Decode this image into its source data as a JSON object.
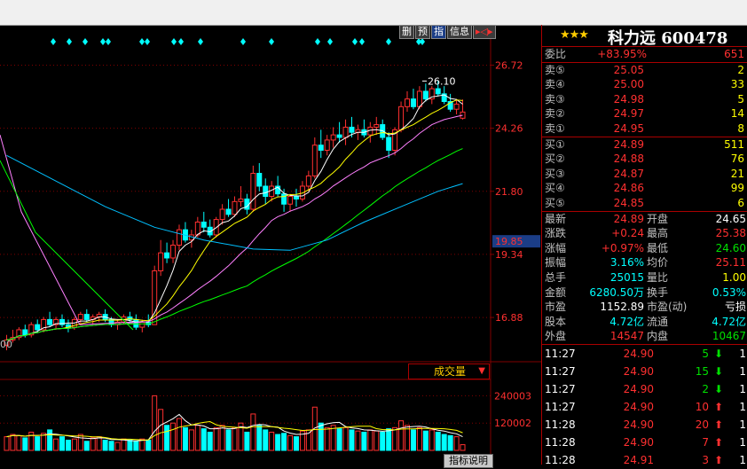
{
  "stock": {
    "stars": "★★★",
    "name": "科力远 600478"
  },
  "toolbox": [
    {
      "label": "删",
      "hl": false
    },
    {
      "label": "预",
      "hl": false
    },
    {
      "label": "指",
      "hl": true
    },
    {
      "label": "信息",
      "hl": false
    },
    {
      "label": "▸◁▸",
      "hl": false
    }
  ],
  "price_axis": {
    "ticks": [
      "26.72",
      "24.26",
      "21.80",
      "19.34",
      "16.88"
    ],
    "highlight": "19.85",
    "peak_label": "26.10",
    "left_label": "00"
  },
  "volume_axis": {
    "ticks": [
      "240003",
      "120002"
    ]
  },
  "volume_dropdown": {
    "label": "成交量",
    "arrow": "▼"
  },
  "indicator_button": "指标说明",
  "order_book": {
    "ratio": {
      "label": "委比",
      "value": "+83.95%",
      "qty": "651"
    },
    "sell": [
      {
        "label": "卖⑤",
        "price": "25.05",
        "qty": "2"
      },
      {
        "label": "卖④",
        "price": "25.00",
        "qty": "33"
      },
      {
        "label": "卖③",
        "price": "24.98",
        "qty": "5"
      },
      {
        "label": "卖②",
        "price": "24.97",
        "qty": "14"
      },
      {
        "label": "卖①",
        "price": "24.95",
        "qty": "8"
      }
    ],
    "buy": [
      {
        "label": "买①",
        "price": "24.89",
        "qty": "511"
      },
      {
        "label": "买②",
        "price": "24.88",
        "qty": "76"
      },
      {
        "label": "买③",
        "price": "24.87",
        "qty": "21"
      },
      {
        "label": "买④",
        "price": "24.86",
        "qty": "99"
      },
      {
        "label": "买⑤",
        "price": "24.85",
        "qty": "6"
      }
    ]
  },
  "stats": [
    {
      "l1": "最新",
      "v1": "24.89",
      "c1": "red",
      "l2": "开盘",
      "v2": "24.65",
      "c2": "white"
    },
    {
      "l1": "涨跌",
      "v1": "+0.24",
      "c1": "red",
      "l2": "最高",
      "v2": "25.38",
      "c2": "red"
    },
    {
      "l1": "涨幅",
      "v1": "+0.97%",
      "c1": "red",
      "l2": "最低",
      "v2": "24.60",
      "c2": "green"
    },
    {
      "l1": "振幅",
      "v1": "3.16%",
      "c1": "cyan",
      "l2": "均价",
      "v2": "25.11",
      "c2": "red"
    },
    {
      "l1": "总手",
      "v1": "25015",
      "c1": "cyan",
      "l2": "量比",
      "v2": "1.00",
      "c2": "yellow"
    },
    {
      "l1": "金额",
      "v1": "6280.50万",
      "c1": "cyan",
      "l2": "换手",
      "v2": "0.53%",
      "c2": "cyan"
    },
    {
      "l1": "市盈",
      "v1": "1152.89",
      "c1": "white",
      "l2": "市盈(动)",
      "v2": "亏损",
      "c2": "white"
    },
    {
      "l1": "股本",
      "v1": "4.72亿",
      "c1": "cyan",
      "l2": "流通",
      "v2": "4.72亿",
      "c2": "cyan"
    },
    {
      "l1": "外盘",
      "v1": "14547",
      "c1": "red",
      "l2": "内盘",
      "v2": "10467",
      "c2": "green"
    }
  ],
  "ticks": [
    {
      "time": "11:27",
      "price": "24.90",
      "vol": "5",
      "dir": "down",
      "n": "1"
    },
    {
      "time": "11:27",
      "price": "24.90",
      "vol": "15",
      "dir": "down",
      "n": "1"
    },
    {
      "time": "11:27",
      "price": "24.90",
      "vol": "2",
      "dir": "down",
      "n": "1"
    },
    {
      "time": "11:27",
      "price": "24.90",
      "vol": "10",
      "dir": "up",
      "n": "1"
    },
    {
      "time": "11:28",
      "price": "24.90",
      "vol": "20",
      "dir": "up",
      "n": "1"
    },
    {
      "time": "11:28",
      "price": "24.90",
      "vol": "7",
      "dir": "up",
      "n": "1"
    },
    {
      "time": "11:28",
      "price": "24.91",
      "vol": "3",
      "dir": "up",
      "n": "1"
    }
  ],
  "colors": {
    "up": "#ff3030",
    "down": "#00ffff",
    "ma5": "#ffffff",
    "ma10": "#ffff00",
    "ma20": "#ff80ff",
    "ma60": "#00ff00",
    "ma120": "#00c0ff",
    "grid": "#800000"
  },
  "chart_data": {
    "type": "candlestick",
    "ylim": [
      15.5,
      27.6
    ],
    "vol_lim": [
      0,
      300000
    ],
    "candles": [
      [
        15.8,
        16.2,
        15.6,
        16.0,
        60000
      ],
      [
        16.0,
        16.4,
        15.9,
        16.1,
        70000
      ],
      [
        16.1,
        16.5,
        16.0,
        16.4,
        65000
      ],
      [
        16.4,
        16.6,
        16.1,
        16.2,
        55000
      ],
      [
        16.2,
        16.7,
        16.1,
        16.6,
        80000
      ],
      [
        16.6,
        16.8,
        16.3,
        16.4,
        60000
      ],
      [
        16.4,
        16.9,
        16.3,
        16.8,
        75000
      ],
      [
        16.8,
        17.1,
        16.5,
        16.6,
        90000
      ],
      [
        16.6,
        16.9,
        16.4,
        16.8,
        50000
      ],
      [
        16.8,
        17.0,
        16.5,
        16.6,
        60000
      ],
      [
        16.6,
        16.8,
        16.3,
        16.5,
        45000
      ],
      [
        16.5,
        16.9,
        16.4,
        16.8,
        50000
      ],
      [
        16.8,
        17.1,
        16.6,
        17.0,
        70000
      ],
      [
        17.0,
        17.2,
        16.7,
        16.8,
        40000
      ],
      [
        16.8,
        17.0,
        16.6,
        16.9,
        55000
      ],
      [
        16.9,
        17.1,
        16.7,
        17.0,
        60000
      ],
      [
        17.0,
        17.2,
        16.7,
        16.8,
        45000
      ],
      [
        16.8,
        16.9,
        16.5,
        16.6,
        40000
      ],
      [
        16.6,
        16.8,
        16.4,
        16.7,
        35000
      ],
      [
        16.7,
        17.0,
        16.6,
        16.9,
        50000
      ],
      [
        16.9,
        17.1,
        16.7,
        16.8,
        45000
      ],
      [
        16.8,
        17.0,
        16.4,
        16.5,
        40000
      ],
      [
        16.5,
        16.8,
        16.3,
        16.7,
        50000
      ],
      [
        16.7,
        17.0,
        16.5,
        16.6,
        45000
      ],
      [
        16.6,
        18.9,
        16.6,
        18.7,
        240000
      ],
      [
        18.7,
        19.9,
        18.5,
        19.4,
        180000
      ],
      [
        19.4,
        19.8,
        19.0,
        19.2,
        110000
      ],
      [
        19.2,
        19.9,
        19.0,
        19.7,
        120000
      ],
      [
        19.7,
        20.5,
        19.5,
        20.3,
        140000
      ],
      [
        20.3,
        20.6,
        19.8,
        19.9,
        100000
      ],
      [
        19.9,
        20.3,
        19.6,
        20.1,
        90000
      ],
      [
        20.1,
        20.8,
        20.0,
        20.6,
        110000
      ],
      [
        20.6,
        21.0,
        20.2,
        20.4,
        95000
      ],
      [
        20.4,
        20.7,
        20.0,
        20.1,
        80000
      ],
      [
        20.1,
        20.8,
        20.0,
        20.7,
        100000
      ],
      [
        20.7,
        21.3,
        20.5,
        21.1,
        110000
      ],
      [
        21.1,
        21.5,
        20.8,
        20.9,
        90000
      ],
      [
        20.9,
        21.6,
        20.8,
        21.4,
        100000
      ],
      [
        21.4,
        22.0,
        21.2,
        21.5,
        120000
      ],
      [
        21.5,
        21.7,
        20.9,
        21.1,
        80000
      ],
      [
        21.1,
        22.8,
        21.0,
        22.5,
        160000
      ],
      [
        22.5,
        22.9,
        21.8,
        22.0,
        110000
      ],
      [
        22.0,
        22.3,
        21.3,
        21.6,
        90000
      ],
      [
        21.6,
        22.2,
        21.4,
        22.0,
        80000
      ],
      [
        22.0,
        22.4,
        21.6,
        21.7,
        70000
      ],
      [
        21.7,
        21.9,
        21.0,
        21.3,
        75000
      ],
      [
        21.3,
        21.7,
        21.0,
        21.6,
        65000
      ],
      [
        21.6,
        21.9,
        21.2,
        21.5,
        60000
      ],
      [
        21.5,
        22.2,
        21.4,
        22.0,
        85000
      ],
      [
        22.0,
        22.6,
        21.8,
        22.4,
        90000
      ],
      [
        22.4,
        23.9,
        22.3,
        23.6,
        190000
      ],
      [
        23.6,
        24.2,
        23.1,
        23.4,
        120000
      ],
      [
        23.4,
        24.0,
        23.2,
        23.8,
        100000
      ],
      [
        23.8,
        24.3,
        23.5,
        24.0,
        110000
      ],
      [
        24.0,
        24.5,
        23.7,
        23.9,
        95000
      ],
      [
        23.9,
        24.6,
        23.6,
        24.3,
        100000
      ],
      [
        24.3,
        24.7,
        23.9,
        24.1,
        90000
      ],
      [
        24.1,
        24.4,
        23.8,
        24.2,
        85000
      ],
      [
        24.2,
        24.6,
        23.9,
        24.0,
        80000
      ],
      [
        24.0,
        24.5,
        23.7,
        24.3,
        90000
      ],
      [
        24.3,
        24.7,
        24.0,
        24.4,
        85000
      ],
      [
        24.4,
        24.6,
        23.8,
        23.9,
        80000
      ],
      [
        23.9,
        24.1,
        23.1,
        23.4,
        95000
      ],
      [
        23.4,
        24.3,
        23.2,
        24.2,
        100000
      ],
      [
        24.2,
        25.3,
        24.1,
        25.1,
        130000
      ],
      [
        25.1,
        25.7,
        24.9,
        25.4,
        110000
      ],
      [
        25.4,
        25.8,
        25.0,
        25.1,
        90000
      ],
      [
        25.1,
        25.9,
        25.0,
        25.7,
        100000
      ],
      [
        25.7,
        26.0,
        25.3,
        25.4,
        85000
      ],
      [
        25.4,
        25.9,
        25.2,
        25.8,
        90000
      ],
      [
        25.8,
        26.1,
        25.5,
        25.6,
        80000
      ],
      [
        25.6,
        25.9,
        25.2,
        25.3,
        70000
      ],
      [
        25.3,
        25.6,
        24.9,
        25.0,
        65000
      ],
      [
        25.0,
        25.4,
        24.8,
        25.2,
        60000
      ],
      [
        24.65,
        25.38,
        24.6,
        24.89,
        25015
      ]
    ],
    "ma120": [
      [
        0,
        23.2
      ],
      [
        8,
        22.2
      ],
      [
        16,
        21.2
      ],
      [
        24,
        20.4
      ],
      [
        32,
        19.9
      ],
      [
        40,
        19.55
      ],
      [
        46,
        19.5
      ],
      [
        52,
        19.9
      ],
      [
        58,
        20.6
      ],
      [
        64,
        21.2
      ],
      [
        70,
        21.8
      ],
      [
        74,
        22.1
      ]
    ]
  }
}
